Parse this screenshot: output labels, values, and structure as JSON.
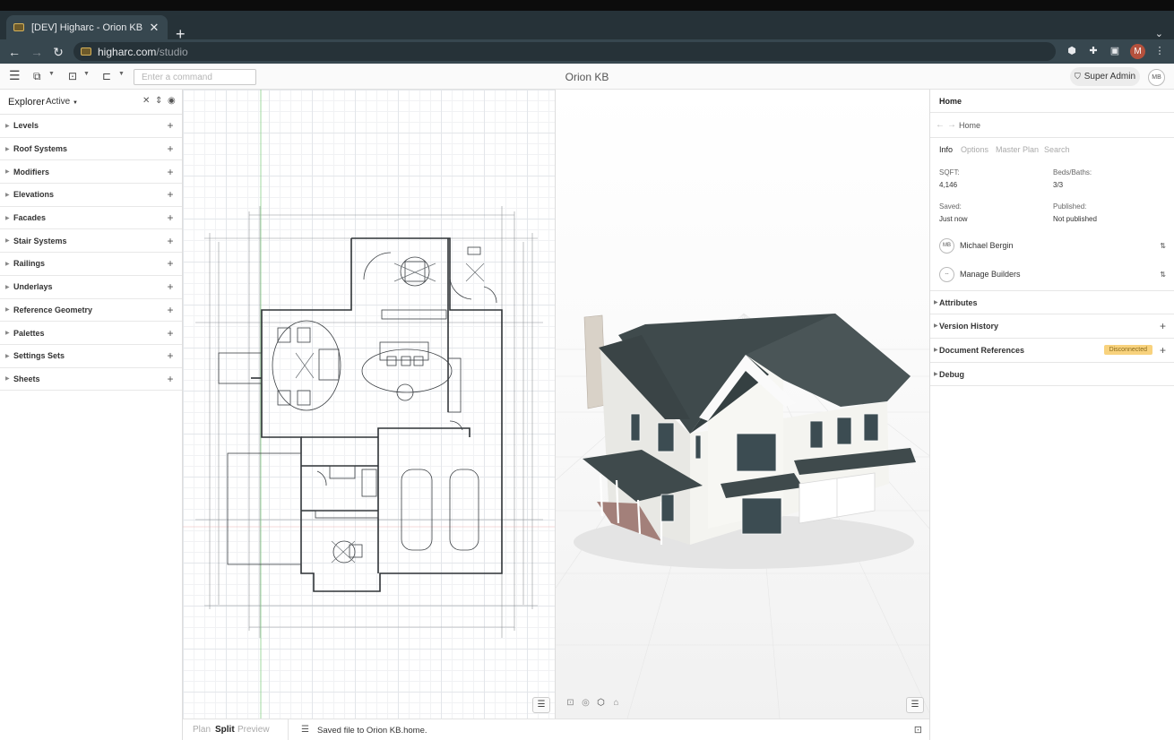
{
  "browser": {
    "tab_title": "[DEV] Higharc - Orion KB",
    "url_host": "higharc.com",
    "url_path": "/studio",
    "profile_initial": "M"
  },
  "header": {
    "command_placeholder": "Enter a command",
    "project_title": "Orion KB",
    "role_button": "Super Admin",
    "user_initials": "MB"
  },
  "explorer": {
    "title": "Explorer",
    "filter": "Active",
    "items": [
      {
        "label": "Levels"
      },
      {
        "label": "Roof Systems"
      },
      {
        "label": "Modifiers"
      },
      {
        "label": "Elevations"
      },
      {
        "label": "Facades"
      },
      {
        "label": "Stair Systems"
      },
      {
        "label": "Railings"
      },
      {
        "label": "Underlays"
      },
      {
        "label": "Reference Geometry"
      },
      {
        "label": "Palettes"
      },
      {
        "label": "Settings Sets"
      },
      {
        "label": "Sheets"
      }
    ]
  },
  "panel": {
    "title": "Home",
    "breadcrumb": "Home",
    "tabs": [
      "Info",
      "Options",
      "Master Plan",
      "Search"
    ],
    "active_tab": "Info",
    "info": {
      "sqft_label": "SQFT:",
      "sqft_value": "4,146",
      "beds_label": "Beds/Baths:",
      "beds_value": "3/3",
      "saved_label": "Saved:",
      "saved_value": "Just now",
      "published_label": "Published:",
      "published_value": "Not published"
    },
    "owner": {
      "initials": "MB",
      "name": "Michael Bergin"
    },
    "builders": {
      "badge": "--",
      "label": "Manage Builders"
    },
    "sections": [
      {
        "label": "Attributes"
      },
      {
        "label": "Version History"
      },
      {
        "label": "Document References",
        "status": "Disconnected"
      },
      {
        "label": "Debug"
      }
    ]
  },
  "bottom": {
    "modes": [
      "Plan",
      "Split",
      "Preview"
    ],
    "active_mode": "Split",
    "status_message": "Saved file to Orion KB.home."
  },
  "colors": {
    "chrome_dark": "#263238",
    "roof": "#3f4a4c",
    "siding": "#f2f2ee",
    "status_badge": "#f8d27d"
  }
}
